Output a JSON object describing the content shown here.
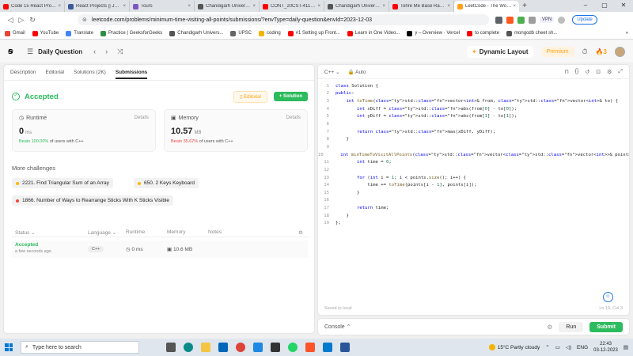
{
  "browser": {
    "tabs": [
      {
        "label": "Code 15 React Projects",
        "color": "#ff0000",
        "active": false
      },
      {
        "label": "React Projects || John S",
        "color": "#3b5998",
        "active": false
      },
      {
        "label": "Tours",
        "color": "#7e57c2",
        "active": false
      },
      {
        "label": "Chandigarh University",
        "color": "#555555",
        "active": false
      },
      {
        "label": "CONT_20CST-411 :: CU",
        "color": "#ff0000",
        "active": false
      },
      {
        "label": "Chandigarh University",
        "color": "#555555",
        "active": false
      },
      {
        "label": "Tohre Me Base Raam",
        "color": "#ff0000",
        "active": false
      },
      {
        "label": "LeetCode - The World",
        "color": "#ffa116",
        "active": true
      }
    ],
    "url": "leetcode.com/problems/minimum-time-visiting-all-points/submissions/?envType=daily-question&envId=2023-12-03",
    "vpn_label": "VPN",
    "update_label": "Update",
    "bookmarks": [
      {
        "label": "Gmail",
        "color": "#ea4335"
      },
      {
        "label": "YouTube",
        "color": "#ff0000"
      },
      {
        "label": "Translate",
        "color": "#4285f4"
      },
      {
        "label": "Practice | GeeksforGeeks",
        "color": "#2f8d46"
      },
      {
        "label": "Chandigarh Univers...",
        "color": "#555555"
      },
      {
        "label": "UPSC",
        "color": "#666666"
      },
      {
        "label": "coding",
        "color": "#f4b400"
      },
      {
        "label": "#1 Setting up Front...",
        "color": "#ff0000"
      },
      {
        "label": "Learn in One Video...",
        "color": "#ff0000"
      },
      {
        "label": "y – Overview · Vercel",
        "color": "#000000"
      },
      {
        "label": "to complete",
        "color": "#ff0000"
      },
      {
        "label": "mongodb cheet sh...",
        "color": "#555555"
      }
    ]
  },
  "lc_header": {
    "title": "Daily Question",
    "dynamic_layout": "Dynamic Layout",
    "premium": "Premium",
    "streak": "3"
  },
  "subtabs": [
    "Description",
    "Editorial",
    "Solutions (2K)",
    "Submissions"
  ],
  "result": {
    "status": "Accepted",
    "editorial_btn": "Editorial",
    "solution_btn": "+ Solution"
  },
  "runtime": {
    "label": "Runtime",
    "details": "Details",
    "value": "0",
    "unit": "ms",
    "beats_pct": "Beats 100.00%",
    "beats_rest": "of users with C++",
    "beats_color": "#2cbb5d"
  },
  "memory": {
    "label": "Memory",
    "details": "Details",
    "value": "10.57",
    "unit": "MB",
    "beats_pct": "Beats 35.67%",
    "beats_rest": "of users with C++",
    "beats_color": "#ef4743"
  },
  "more_challenges": {
    "title": "More challenges",
    "items": [
      {
        "label": "2221. Find Triangular Sum of an Array",
        "color": "#ffb800"
      },
      {
        "label": "650. 2 Keys Keyboard",
        "color": "#ffb800"
      },
      {
        "label": "1866. Number of Ways to Rearrange Sticks With K Sticks Visible",
        "color": "#ef4743"
      }
    ]
  },
  "table": {
    "headers": [
      "Status",
      "Language",
      "Runtime",
      "Memory",
      "Notes"
    ],
    "row": {
      "status": "Accepted",
      "time": "a few seconds ago",
      "language": "C++",
      "runtime": "0 ms",
      "memory": "10.6 MB"
    }
  },
  "editor": {
    "language": "C++",
    "auto": "Auto",
    "saved": "Saved to local",
    "cursor": "Ln 19, Col 3",
    "lines": [
      "class Solution {",
      "public:",
      "    int toTime(std::vector<int>& from, std::vector<int>& to) {",
      "        int xDiff = std::abs(from[0] - to[0]);",
      "        int yDiff = std::abs(from[1] - to[1]);",
      "",
      "        return std::max(xDiff, yDiff);",
      "    }",
      "",
      "    int minTimeToVisitAllPoints(std::vector<std::vector<int>>& points) {",
      "        int time = 0;",
      "",
      "        for (int i = 1; i < points.size(); i++) {",
      "            time += toTime(points[i - 1], points[i]);",
      "        }",
      "",
      "        return time;",
      "    }",
      "};"
    ]
  },
  "console": {
    "label": "Console",
    "run": "Run",
    "submit": "Submit"
  },
  "taskbar": {
    "search_placeholder": "Type here to search",
    "weather": "15°C  Partly cloudy",
    "lang": "ENG",
    "time": "22:43",
    "date": "03-12-2023"
  }
}
